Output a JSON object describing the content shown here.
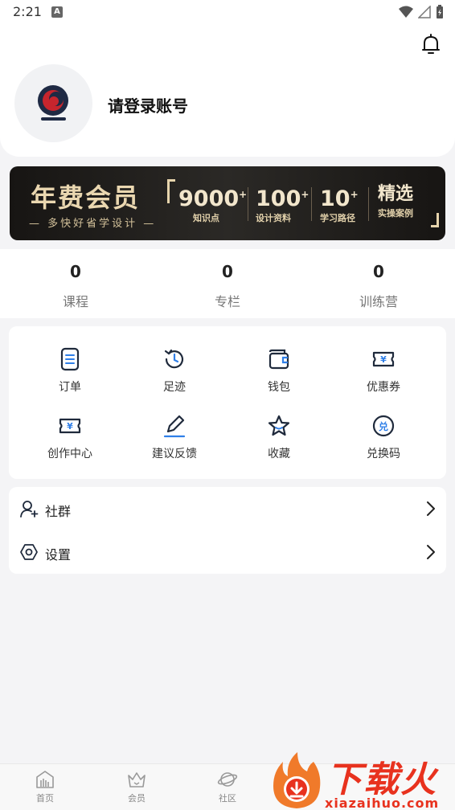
{
  "status_bar": {
    "time": "2:21",
    "notification_letter": "A"
  },
  "profile": {
    "login_prompt": "请登录账号"
  },
  "banner": {
    "title": "年费会员",
    "subtitle": "— 多快好省学设计 —",
    "stats": [
      {
        "value": "9000",
        "suffix": "+",
        "label": "知识点"
      },
      {
        "value": "100",
        "suffix": "+",
        "label": "设计资料"
      },
      {
        "value": "10",
        "suffix": "+",
        "label": "学习路径"
      },
      {
        "value": "精选",
        "suffix": "",
        "label": "实操案例"
      }
    ]
  },
  "stats": [
    {
      "value": "0",
      "label": "课程"
    },
    {
      "value": "0",
      "label": "专栏"
    },
    {
      "value": "0",
      "label": "训练营"
    }
  ],
  "grid": [
    {
      "label": "订单",
      "icon": "order-icon"
    },
    {
      "label": "足迹",
      "icon": "history-icon"
    },
    {
      "label": "钱包",
      "icon": "wallet-icon"
    },
    {
      "label": "优惠券",
      "icon": "coupon-icon"
    },
    {
      "label": "创作中心",
      "icon": "creation-icon"
    },
    {
      "label": "建议反馈",
      "icon": "feedback-pen-icon"
    },
    {
      "label": "收藏",
      "icon": "star-icon"
    },
    {
      "label": "兑换码",
      "icon": "redeem-icon"
    }
  ],
  "list": [
    {
      "label": "社群",
      "icon": "community-icon"
    },
    {
      "label": "设置",
      "icon": "settings-icon"
    }
  ],
  "tabs": [
    {
      "label": "首页",
      "icon": "home-icon"
    },
    {
      "label": "会员",
      "icon": "crown-icon"
    },
    {
      "label": "社区",
      "icon": "planet-icon"
    }
  ],
  "watermark": {
    "brand": "下载火",
    "url": "xiazaihuo.com"
  },
  "colors": {
    "accent": "#2f7fe8",
    "icon_dark": "#1f2a3c",
    "banner_gold": "#ead7b0",
    "watermark_red": "#e8321e"
  }
}
